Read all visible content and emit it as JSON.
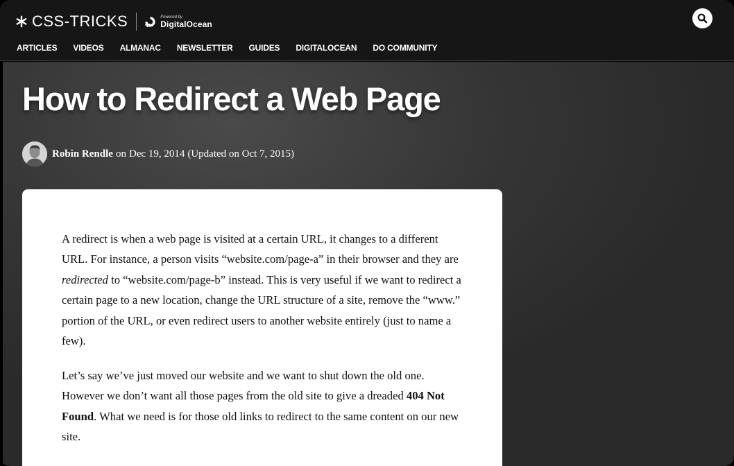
{
  "header": {
    "logo_text": "CSS-TRICKS",
    "powered_by": "Powered by",
    "partner": "DigitalOcean",
    "nav": [
      "ARTICLES",
      "VIDEOS",
      "ALMANAC",
      "NEWSLETTER",
      "GUIDES",
      "DIGITALOCEAN",
      "DO COMMUNITY"
    ]
  },
  "article": {
    "title": "How to Redirect a Web Page",
    "author": "Robin Rendle",
    "on": "on",
    "date": "Dec 19, 2014",
    "updated": "(Updated on Oct 7, 2015)",
    "p1_a": "A redirect is when a web page is visited at a certain URL, it changes to a different URL. For instance, a person visits “website.com/page-a” in their browser and they are ",
    "p1_em": "redirected",
    "p1_b": " to “website.com/page-b” instead. This is very useful if we want to redirect a certain page to a new location, change the URL structure of a site, remove the “www.” portion of the URL, or even redirect users to another website entirely (just to name a few).",
    "p2_a": "Let’s say we’ve just moved our website and we want to shut down the old one. However we don’t want all those pages from the old site to give a dreaded ",
    "p2_strong": "404 Not Found",
    "p2_b": ". What we need is for those old links to redirect to the same content on our new site."
  },
  "colors": {
    "header_bg": "#161616",
    "hero_bg": "#353535",
    "card_bg": "#ffffff"
  },
  "icons": {
    "logo": "asterisk-icon",
    "partner": "digitalocean-logo-icon",
    "search": "search-icon"
  }
}
